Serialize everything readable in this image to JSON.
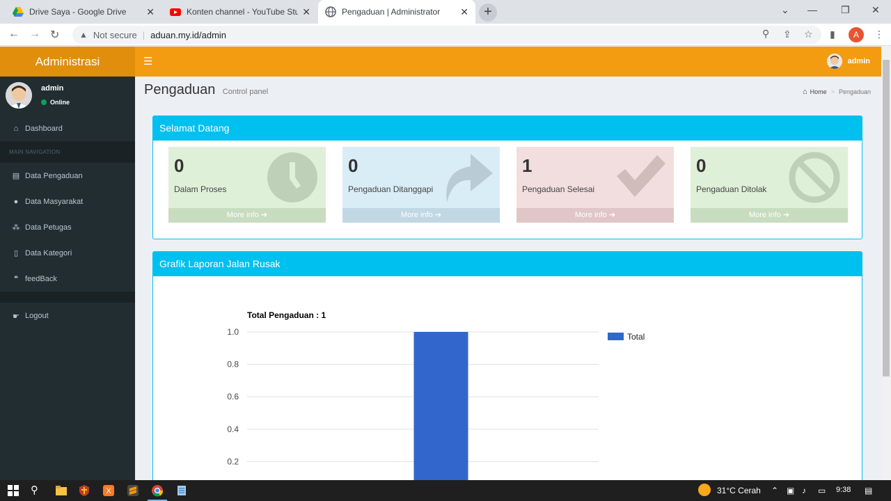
{
  "browser": {
    "tabs": [
      {
        "label": "Drive Saya - Google Drive",
        "icon": "google-drive-icon"
      },
      {
        "label": "Konten channel - YouTube Studio",
        "icon": "youtube-icon"
      },
      {
        "label": "Pengaduan | Administrator",
        "icon": "globe-icon"
      }
    ],
    "not_secure": "Not secure",
    "url": "aduan.my.id/admin",
    "profile_initial": "A"
  },
  "app": {
    "brand": "Administrasi",
    "user": "admin",
    "status": "Online"
  },
  "sidebar": {
    "dashboard": "Dashboard",
    "header": "MAIN NAVIGATION",
    "items": [
      {
        "label": "Data Pengaduan",
        "icon": "table-icon"
      },
      {
        "label": "Data Masyarakat",
        "icon": "user-icon"
      },
      {
        "label": "Data Petugas",
        "icon": "users-icon"
      },
      {
        "label": "Data Kategori",
        "icon": "file-icon"
      },
      {
        "label": "feedBack",
        "icon": "comments-icon"
      }
    ],
    "logout": "Logout"
  },
  "page": {
    "title": "Pengaduan",
    "subtitle": "Control panel",
    "breadcrumb": [
      "Home",
      "Pengaduan"
    ]
  },
  "welcome_box": {
    "title": "Selamat Datang",
    "tiles": [
      {
        "value": "0",
        "label": "Dalam Proses",
        "more": "More info",
        "icon": "clock-icon",
        "bg": "#dff0d8",
        "footer": "#c8dcc0"
      },
      {
        "value": "0",
        "label": "Pengaduan Ditanggapi",
        "more": "More info",
        "icon": "share-arrow-icon",
        "bg": "#d9edf7",
        "footer": "#c1d7e4"
      },
      {
        "value": "1",
        "label": "Pengaduan Selesai",
        "more": "More info",
        "icon": "check-icon",
        "bg": "#f2dede",
        "footer": "#e0c6c6"
      },
      {
        "value": "0",
        "label": "Pengaduan Ditolak",
        "more": "More info",
        "icon": "ban-icon",
        "bg": "#dff0d8",
        "footer": "#c8dcc0"
      }
    ]
  },
  "chart_box": {
    "title": "Grafik Laporan Jalan Rusak"
  },
  "chart_data": {
    "type": "bar",
    "title": "Total Pengaduan : 1",
    "categories": [
      ""
    ],
    "series": [
      {
        "name": "Total",
        "values": [
          1
        ],
        "color": "#3366cc"
      }
    ],
    "yticks": [
      "1.0",
      "0.8",
      "0.6",
      "0.4",
      "0.2"
    ],
    "ylim": [
      0,
      1
    ],
    "legend": "right",
    "grid": true
  },
  "taskbar": {
    "weather": "31°C  Cerah",
    "time": "9:38"
  }
}
